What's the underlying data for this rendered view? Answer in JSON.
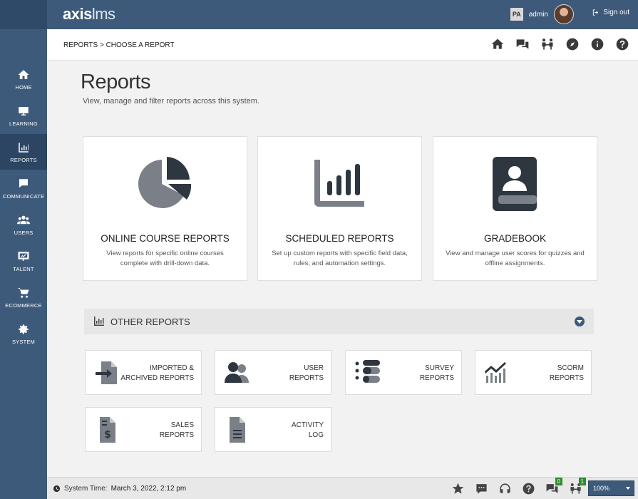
{
  "app": {
    "logo_bold": "axis",
    "logo_light": "lms",
    "user_initials": "PA",
    "user_name": "admin",
    "sign_out": "Sign out"
  },
  "sidebar": {
    "items": [
      {
        "label": "HOME",
        "icon": "home-icon"
      },
      {
        "label": "LEARNING",
        "icon": "monitor-icon"
      },
      {
        "label": "REPORTS",
        "icon": "bar-chart-icon",
        "active": true
      },
      {
        "label": "COMMUNICATE",
        "icon": "chat-icon"
      },
      {
        "label": "USERS",
        "icon": "users-icon"
      },
      {
        "label": "TALENT",
        "icon": "presentation-icon"
      },
      {
        "label": "ECOMMERCE",
        "icon": "cart-icon"
      },
      {
        "label": "SYSTEM",
        "icon": "gear-icon"
      }
    ]
  },
  "breadcrumb": {
    "part1": "REPORTS",
    "part2": "> CHOOSE A REPORT"
  },
  "toolbar_icons": [
    "home-icon",
    "chat-icon",
    "people-icon",
    "compass-icon",
    "info-icon",
    "help-icon"
  ],
  "page": {
    "title": "Reports",
    "subtitle": "View, manage and filter reports across this system."
  },
  "cards": [
    {
      "title": "ONLINE COURSE REPORTS",
      "desc": "View reports for specific online courses complete with drill-down data.",
      "icon": "pie-chart-icon"
    },
    {
      "title": "SCHEDULED REPORTS",
      "desc": "Set up custom reports with specific field data, rules, and automation settings.",
      "icon": "bar-chart-icon"
    },
    {
      "title": "GRADEBOOK",
      "desc": "View and manage user scores for quizzes and offline assignments.",
      "icon": "gradebook-icon"
    }
  ],
  "other_reports": {
    "title": "OTHER REPORTS",
    "tiles": [
      {
        "line1": "IMPORTED &",
        "line2": "ARCHIVED REPORTS",
        "icon": "file-import-icon"
      },
      {
        "line1": "USER",
        "line2": "REPORTS",
        "icon": "users-icon"
      },
      {
        "line1": "SURVEY",
        "line2": "REPORTS",
        "icon": "survey-icon"
      },
      {
        "line1": "SCORM",
        "line2": "REPORTS",
        "icon": "trend-chart-icon"
      },
      {
        "line1": "SALES",
        "line2": "REPORTS",
        "icon": "invoice-icon"
      },
      {
        "line1": "ACTIVITY",
        "line2": "LOG",
        "icon": "file-lines-icon"
      }
    ]
  },
  "footer": {
    "label": "System Time:",
    "value": "March 3, 2022, 2:12 pm",
    "badge_chat": "0",
    "badge_people": "1",
    "zoom": "100%"
  },
  "colors": {
    "sidebar": "#3d5a7a",
    "sidebar_active": "#2b4563",
    "icon_dark": "#2e3640",
    "icon_gray": "#7b8088",
    "badge": "#2e8b2e"
  }
}
